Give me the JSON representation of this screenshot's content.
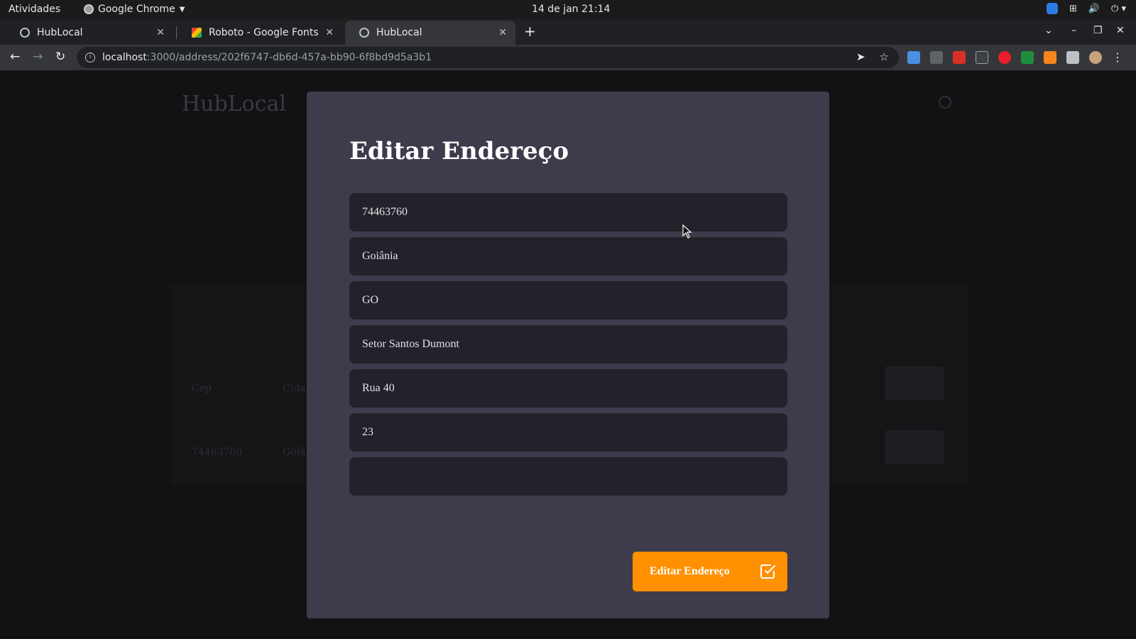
{
  "os": {
    "activities": "Atividades",
    "app_name": "Google Chrome",
    "clock": "14 de jan  21:14"
  },
  "browser": {
    "tabs": [
      {
        "label": "HubLocal",
        "favicon": "globe-icon"
      },
      {
        "label": "Roboto - Google Fonts",
        "favicon": "google-fonts-icon"
      },
      {
        "label": "HubLocal",
        "favicon": "globe-icon"
      }
    ],
    "url_host": "localhost",
    "url_path": ":3000/address/202f6747-db6d-457a-bb90-6f8bd9d5a3b1"
  },
  "background": {
    "brand": "HubLocal",
    "table_headers": [
      "Cep",
      "Cida"
    ],
    "row": [
      "74463760",
      "Goiâ"
    ]
  },
  "modal": {
    "title": "Editar Endereço",
    "fields": [
      {
        "value": "74463760",
        "placeholder": ""
      },
      {
        "value": "Goiânia",
        "placeholder": ""
      },
      {
        "value": "GO",
        "placeholder": ""
      },
      {
        "value": "Setor Santos Dumont",
        "placeholder": ""
      },
      {
        "value": "Rua 40",
        "placeholder": ""
      },
      {
        "value": "23",
        "placeholder": ""
      },
      {
        "value": "",
        "placeholder": ""
      }
    ],
    "submit_label": "Editar Endereço"
  },
  "colors": {
    "accent": "#ff9000",
    "modal_bg": "#3e3b4b",
    "field_bg": "#232129",
    "page_bg": "#121214"
  }
}
